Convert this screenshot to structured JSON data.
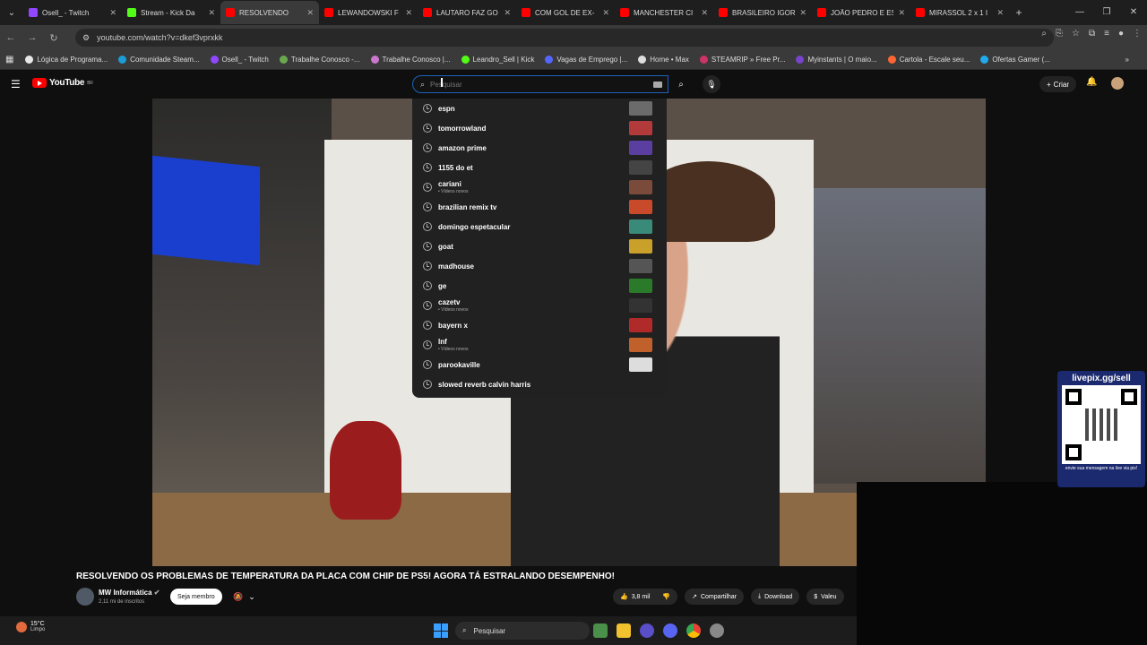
{
  "browser": {
    "tabs": [
      {
        "label": "Osell_ - Twitch",
        "color": "#9146ff",
        "active": false
      },
      {
        "label": "Stream - Kick Da",
        "color": "#53fc18",
        "active": false
      },
      {
        "label": "RESOLVENDO",
        "color": "#ff0000",
        "active": true
      },
      {
        "label": "LEWANDOWSKI F",
        "color": "#ff0000",
        "active": false
      },
      {
        "label": "LAUTARO FAZ GO",
        "color": "#ff0000",
        "active": false
      },
      {
        "label": "COM GOL DE EX-",
        "color": "#ff0000",
        "active": false
      },
      {
        "label": "MANCHESTER CI",
        "color": "#ff0000",
        "active": false
      },
      {
        "label": "BRASILEIRO IGOR",
        "color": "#ff0000",
        "active": false
      },
      {
        "label": "JOÃO PEDRO E ES",
        "color": "#ff0000",
        "active": false
      },
      {
        "label": "MIRASSOL 2 x 1 I",
        "color": "#ff0000",
        "active": false
      }
    ],
    "url": "youtube.com/watch?v=dkef3vprxkk",
    "bookmarks": [
      {
        "label": "Lógica de Programa...",
        "color": "#e8e8e8"
      },
      {
        "label": "Comunidade Steam...",
        "color": "#1b9dd9"
      },
      {
        "label": "Osell_ - Twitch",
        "color": "#9146ff"
      },
      {
        "label": "Trabalhe Conosco -...",
        "color": "#6aa84f"
      },
      {
        "label": "Trabalhe Conosco |...",
        "color": "#cc77cc"
      },
      {
        "label": "Leandro_Sell | Kick",
        "color": "#53fc18"
      },
      {
        "label": "Vagas de Emprego |...",
        "color": "#5566ff"
      },
      {
        "label": "Home • Max",
        "color": "#dddddd"
      },
      {
        "label": "STEAMRIP » Free Pr...",
        "color": "#cc3366"
      },
      {
        "label": "Myinstants | O maio...",
        "color": "#7744cc"
      },
      {
        "label": "Cartola - Escale seu...",
        "color": "#ff6633"
      },
      {
        "label": "Ofertas Gamer (...",
        "color": "#22aaee"
      }
    ]
  },
  "youtube": {
    "logo_text": "YouTube",
    "logo_region": "BR",
    "search_placeholder": "Pesquisar",
    "create_label": "Criar",
    "suggestions": [
      {
        "text": "espn",
        "sub": "",
        "thumb": "#6b6b6b"
      },
      {
        "text": "tomorrowland",
        "sub": "",
        "thumb": "#b33a3a"
      },
      {
        "text": "amazon prime",
        "sub": "",
        "thumb": "#5a3fa0"
      },
      {
        "text": "1155 do et",
        "sub": "",
        "thumb": "#444444"
      },
      {
        "text": "cariani",
        "sub": "• Vídeos novos",
        "thumb": "#7a4a3a"
      },
      {
        "text": "brazilian remix tv",
        "sub": "",
        "thumb": "#c84a2a"
      },
      {
        "text": "domingo espetacular",
        "sub": "",
        "thumb": "#3a8a7a"
      },
      {
        "text": "goat",
        "sub": "",
        "thumb": "#c9a02a"
      },
      {
        "text": "madhouse",
        "sub": "",
        "thumb": "#555555"
      },
      {
        "text": "ge",
        "sub": "",
        "thumb": "#2a7a2a"
      },
      {
        "text": "cazetv",
        "sub": "• Vídeos novos",
        "thumb": "#333333"
      },
      {
        "text": "bayern x",
        "sub": "",
        "thumb": "#b02a2a"
      },
      {
        "text": "lnf",
        "sub": "• Vídeos novos",
        "thumb": "#c0602a"
      },
      {
        "text": "parookaville",
        "sub": "",
        "thumb": "#dddddd"
      },
      {
        "text": "slowed reverb calvin harris",
        "sub": "",
        "thumb": ""
      }
    ]
  },
  "video": {
    "title": "RESOLVENDO OS PROBLEMAS DE TEMPERATURA DA PLACA COM CHIP DE PS5! AGORA TÁ ESTRALANDO DESEMPENHO!",
    "channel": "MW Informática",
    "subscribers": "2,11 mi de inscritos",
    "member_label": "Seja membro",
    "likes": "3,8 mil",
    "share_label": "Compartilhar",
    "download_label": "Download",
    "thanks_label": "Valeu"
  },
  "overlay": {
    "header": "livepix.gg/sell",
    "footer": "envie sua mensagem na live via pix!"
  },
  "taskbar": {
    "temperature": "15°C",
    "condition": "Limpo",
    "search_label": "Pesquisar"
  }
}
